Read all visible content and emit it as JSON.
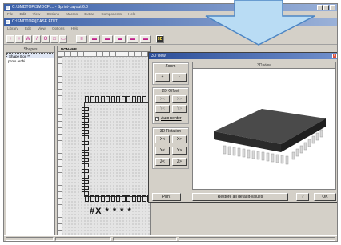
{
  "app": {
    "title": "C:\\SMDTOP\\SMDCF\\... - Sprint-Layout 6.0",
    "menu": [
      "File",
      "Edit",
      "View",
      "Options",
      "Macros",
      "Extras",
      "Components",
      "Help"
    ],
    "sub_title": "C:\\SMDTOP\\[CASE EDIT]",
    "sub_menu": [
      "Library",
      "Edit",
      "View",
      "Options",
      "Help"
    ]
  },
  "toolbar": {
    "buttons": [
      "+",
      "+",
      "W",
      "/",
      "O",
      "□",
      "▭",
      "≡",
      "▬",
      "▬",
      "▬",
      "▬",
      "▬"
    ],
    "view3d_label": "3D"
  },
  "shapes": {
    "tab_label": "Shapes",
    "items": [
      "Shape Box **",
      "proto archi"
    ]
  },
  "editor": {
    "doc_tab": "NONAME",
    "refdes": "#X * * * *"
  },
  "dialog": {
    "title": "3D view",
    "zoom": {
      "label": "Zoom",
      "plus": "+",
      "minus": "-"
    },
    "offset": {
      "label": "2D Offset",
      "b1": "X<",
      "b2": "X>",
      "b3": "Y<",
      "b4": "Y>",
      "auto_center": "Auto center",
      "auto_center_checked": true
    },
    "rotation": {
      "label": "3D Rotation",
      "x_minus": "X<",
      "x_plus": "X>",
      "y_minus": "Y<",
      "y_plus": "Y>",
      "z_minus": "Z<",
      "z_plus": "Z>"
    },
    "view_header": "3D view",
    "print_label": "Print",
    "restore_label": "Restore all default-values",
    "help_label": "?",
    "ok_label": "OK"
  },
  "colors": {
    "title_gradient_start": "#3a5fa8",
    "arrow_fill": "#b9dcf4",
    "arrow_stroke": "#4d86c4",
    "chip_body": "#3a3a3a",
    "pin_color": "#cfcfcf"
  }
}
